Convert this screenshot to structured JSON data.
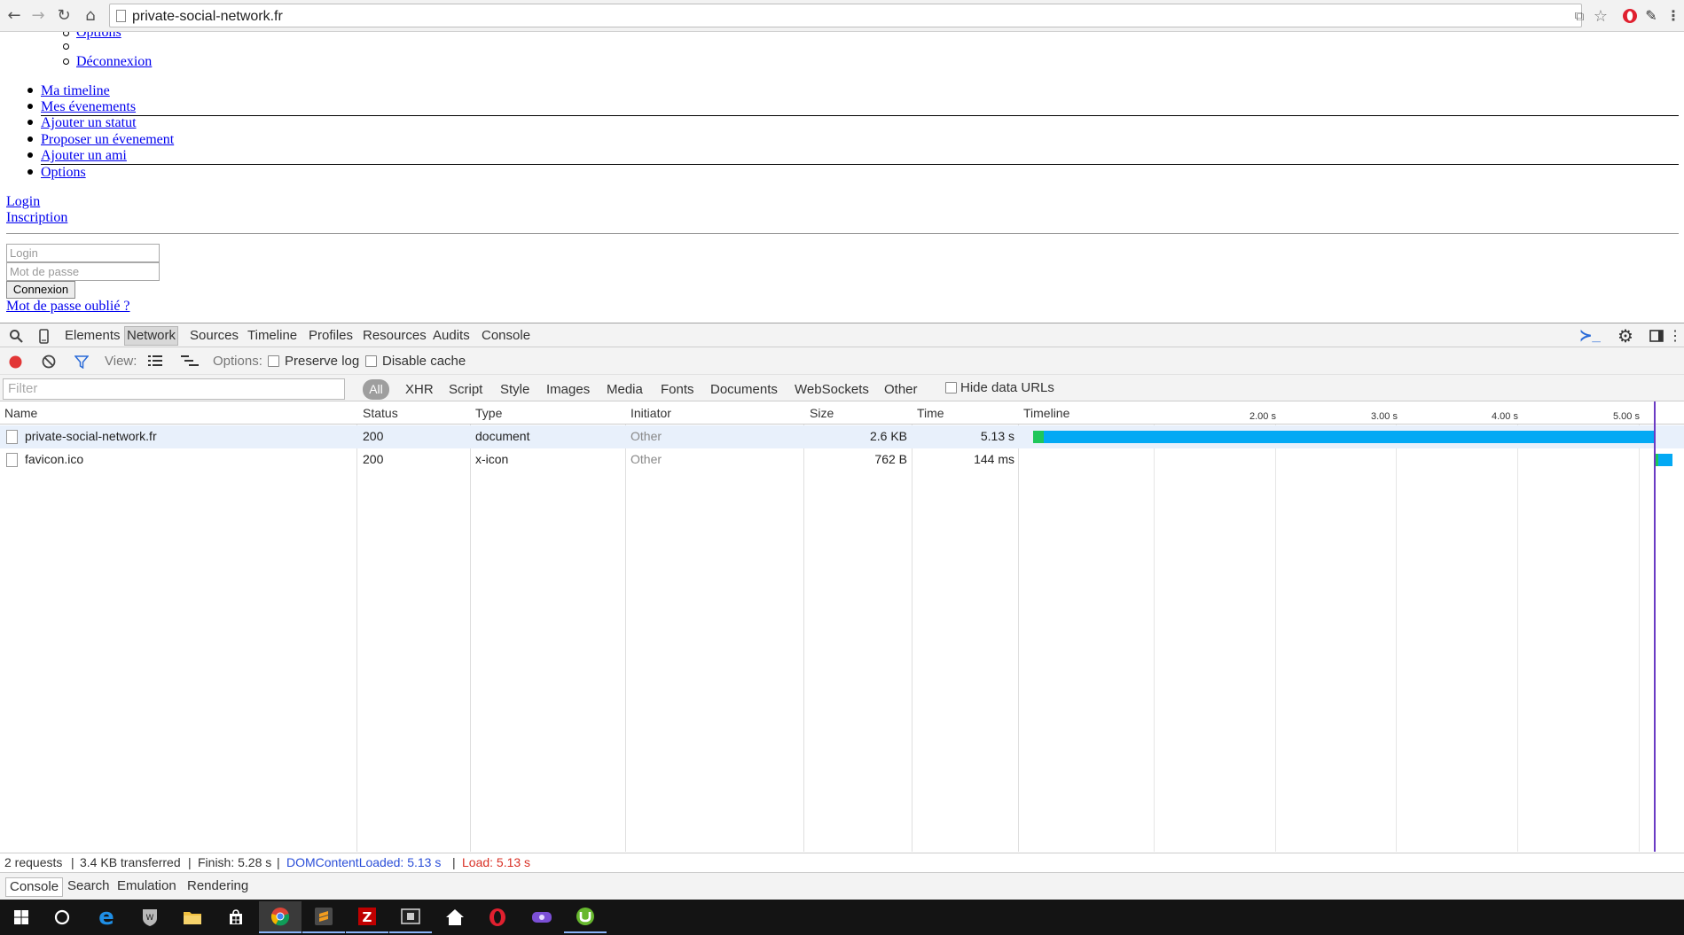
{
  "browser": {
    "url": "private-social-network.fr",
    "back_icon": "arrow-left-icon",
    "forward_icon": "arrow-right-icon",
    "reload_icon": "reload-icon",
    "home_icon": "home-icon"
  },
  "page": {
    "sub_menu": {
      "options_label": " Options",
      "logout_label": " Déconnexion"
    },
    "main_menu": [
      " Ma timeline",
      " Mes évenements",
      " Ajouter un statut",
      " Proposer un évenement",
      " Ajouter un ami",
      " Options"
    ],
    "auth_links": {
      "login": "Login",
      "signup": "Inscription"
    },
    "login_form": {
      "login_placeholder": "Login",
      "password_placeholder": "Mot de passe",
      "submit_label": "Connexion",
      "forgot_label": "Mot de passe oublié ?"
    }
  },
  "devtools": {
    "tabs": [
      "Elements",
      "Network",
      "Sources",
      "Timeline",
      "Profiles",
      "Resources",
      "Audits",
      "Console"
    ],
    "active_tab": "Network",
    "toolbar": {
      "view_label": "View:",
      "options_label": "Options:",
      "preserve_log": "Preserve log",
      "disable_cache": "Disable cache"
    },
    "filter": {
      "placeholder": "Filter",
      "types": [
        "All",
        "XHR",
        "Script",
        "Style",
        "Images",
        "Media",
        "Fonts",
        "Documents",
        "WebSockets",
        "Other"
      ],
      "hide_data_urls": "Hide data URLs"
    },
    "columns": {
      "name": "Name",
      "status": "Status",
      "type": "Type",
      "initiator": "Initiator",
      "size": "Size",
      "time": "Time",
      "timeline": "Timeline"
    },
    "timeline_ticks": [
      "2.00 s",
      "3.00 s",
      "4.00 s",
      "5.00 s"
    ],
    "requests": [
      {
        "name": "private-social-network.fr",
        "status": "200",
        "type": "document",
        "initiator": "Other",
        "size": "2.6 KB",
        "time": "5.13 s"
      },
      {
        "name": "favicon.ico",
        "status": "200",
        "type": "x-icon",
        "initiator": "Other",
        "size": "762 B",
        "time": "144 ms"
      }
    ],
    "status_bar": {
      "requests": "2 requests",
      "transferred": "3.4 KB transferred",
      "finish": "Finish: 5.28 s",
      "dom_content_loaded": "DOMContentLoaded: 5.13 s",
      "load": "Load: 5.13 s",
      "dom_color": "#2a4ed8",
      "load_color": "#d93025"
    },
    "drawer_tabs": [
      "Console",
      "Search",
      "Emulation",
      "Rendering"
    ]
  },
  "colors": {
    "timeline_waiting": "#1ec75a",
    "timeline_receiving": "#03a9f4",
    "load_line": "#6a3bc4"
  },
  "taskbar": {
    "apps": [
      "windows-start-icon",
      "cortana-icon",
      "edge-icon",
      "world-of-tanks-icon",
      "file-explorer-icon",
      "store-icon",
      "chrome-icon",
      "sublime-text-icon",
      "filezilla-icon",
      "media-player-icon",
      "home-app-icon",
      "opera-icon",
      "gamepad-app-icon",
      "utorrent-icon"
    ]
  }
}
